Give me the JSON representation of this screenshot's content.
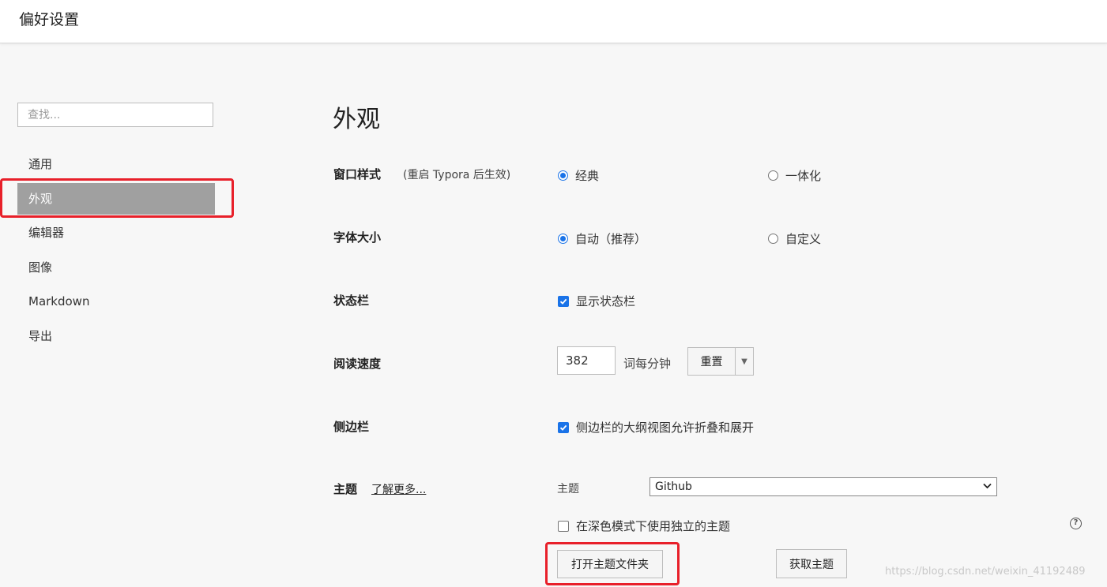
{
  "window": {
    "title": "偏好设置"
  },
  "sidebar": {
    "search_placeholder": "查找...",
    "items": [
      {
        "label": "通用"
      },
      {
        "label": "外观",
        "active": true
      },
      {
        "label": "编辑器"
      },
      {
        "label": "图像"
      },
      {
        "label": "Markdown"
      },
      {
        "label": "导出"
      }
    ]
  },
  "main": {
    "title": "外观",
    "window_style": {
      "label": "窗口样式",
      "note": "(重启 Typora 后生效)",
      "options": [
        {
          "label": "经典",
          "selected": true
        },
        {
          "label": "一体化",
          "selected": false
        }
      ]
    },
    "font_size": {
      "label": "字体大小",
      "options": [
        {
          "label": "自动（推荐）",
          "selected": true
        },
        {
          "label": "自定义",
          "selected": false
        }
      ]
    },
    "status_bar": {
      "label": "状态栏",
      "checkbox_label": "显示状态栏",
      "checked": true
    },
    "reading_speed": {
      "label": "阅读速度",
      "value": "382",
      "unit": "词每分钟",
      "reset_label": "重置",
      "dropdown_arrow": "▼"
    },
    "sidebar_setting": {
      "label": "侧边栏",
      "checkbox_label": "侧边栏的大纲视图允许折叠和展开",
      "checked": true
    },
    "theme": {
      "label": "主题",
      "learn_more": "了解更多...",
      "select_label": "主题",
      "selected": "Github",
      "dark_mode_label": "在深色模式下使用独立的主题",
      "dark_mode_checked": false,
      "help_icon": "?",
      "open_folder_label": "打开主题文件夹",
      "get_themes_label": "获取主题"
    }
  },
  "watermark": "https://blog.csdn.net/weixin_41192489",
  "colors": {
    "accent": "#1a73e8",
    "active_nav": "#a0a0a0",
    "highlight": "#e8202a"
  }
}
